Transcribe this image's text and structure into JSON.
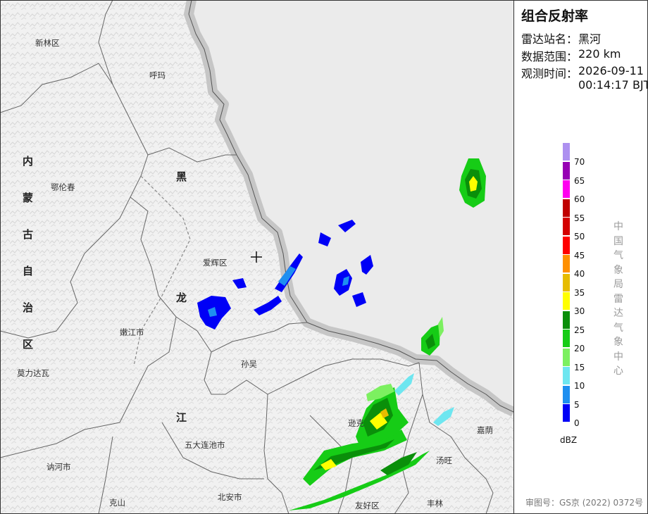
{
  "panel": {
    "title": "组合反射率",
    "station_label": "雷达站名：",
    "station_value": "黑河",
    "range_label": "数据范围：",
    "range_value": "220 km",
    "time_label": "观测时间：",
    "time_date": "2026-09-11",
    "time_clock": "00:14:17 BJT",
    "unit": "dBZ",
    "agency": "中国气象局雷达气象中心",
    "approval": "审图号：GS京 (2022) 0372号"
  },
  "legend": [
    {
      "label": "0",
      "color": "#0000f6"
    },
    {
      "label": "5",
      "color": "#1e8ff0"
    },
    {
      "label": "10",
      "color": "#6ee6f0"
    },
    {
      "label": "15",
      "color": "#7cf060"
    },
    {
      "label": "20",
      "color": "#16cc16"
    },
    {
      "label": "25",
      "color": "#0a8f0a"
    },
    {
      "label": "30",
      "color": "#ffff00"
    },
    {
      "label": "35",
      "color": "#e6bc00"
    },
    {
      "label": "40",
      "color": "#ff9000"
    },
    {
      "label": "45",
      "color": "#ff0000"
    },
    {
      "label": "50",
      "color": "#d40000"
    },
    {
      "label": "55",
      "color": "#c00000"
    },
    {
      "label": "60",
      "color": "#ff00f0"
    },
    {
      "label": "65",
      "color": "#9600b4"
    },
    {
      "label": "70",
      "color": "#ad90f0"
    }
  ],
  "map": {
    "places": [
      "新林区",
      "呼玛",
      "鄂伦春",
      "爱辉区",
      "嫩江市",
      "孙吴",
      "莫力达瓦",
      "逊克",
      "嘉荫",
      "五大连池市",
      "汤旺",
      "讷河市",
      "克山",
      "北安市",
      "友好区",
      "丰林"
    ],
    "provinces": [
      "内",
      "蒙",
      "古",
      "自",
      "治",
      "区",
      "黑",
      "龙",
      "江"
    ],
    "station_marker": "radar-station-marker"
  }
}
